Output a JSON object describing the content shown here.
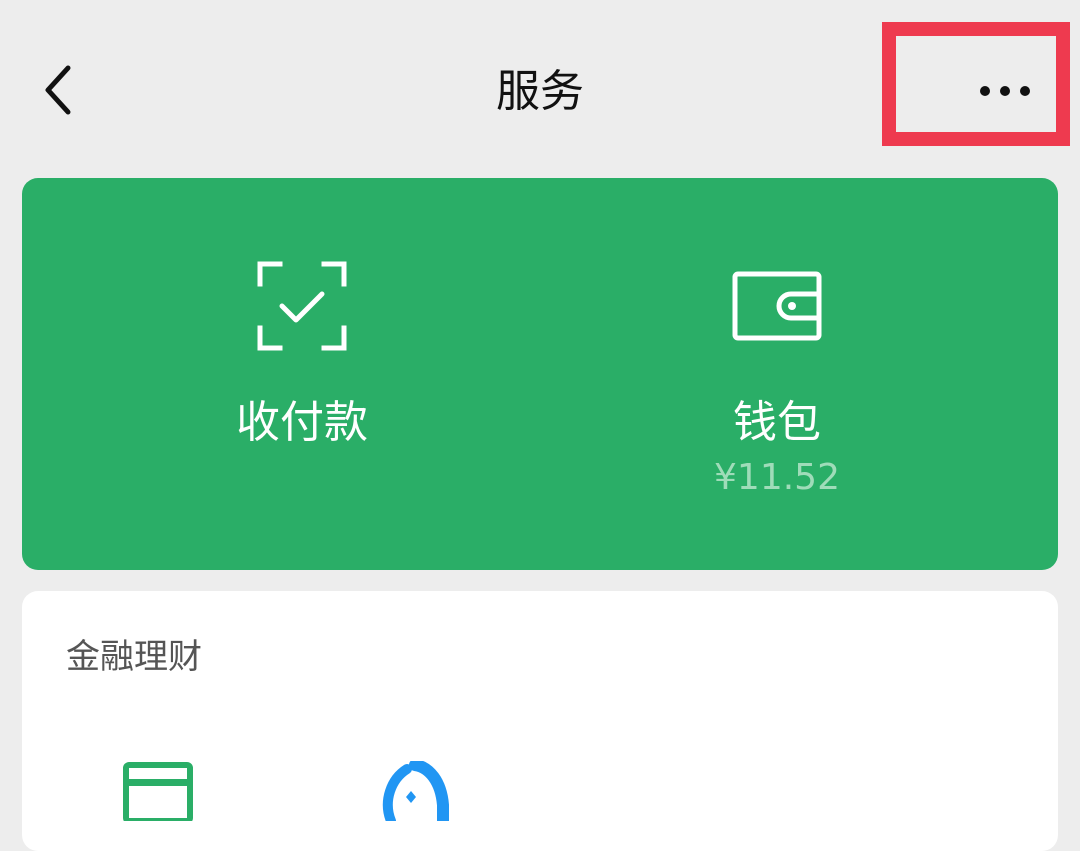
{
  "header": {
    "back_icon": "chevron-left-icon",
    "title": "服务",
    "more_icon": "more-dots-icon"
  },
  "colors": {
    "page_background": "#ededed",
    "green_card": "#2aae67",
    "green_subtext": "#9fdcb9",
    "highlight_box": "#ee3a4f",
    "finance_green": "#2aae67",
    "finance_blue": "#2196f3"
  },
  "green_card": {
    "items": [
      {
        "icon": "scan-check-icon",
        "label": "收付款"
      },
      {
        "icon": "wallet-icon",
        "label": "钱包",
        "balance": "¥11.52"
      }
    ]
  },
  "finance": {
    "title": "金融理财",
    "items": [
      {
        "icon": "credit-card-icon"
      },
      {
        "icon": "wealth-drop-icon"
      }
    ]
  }
}
